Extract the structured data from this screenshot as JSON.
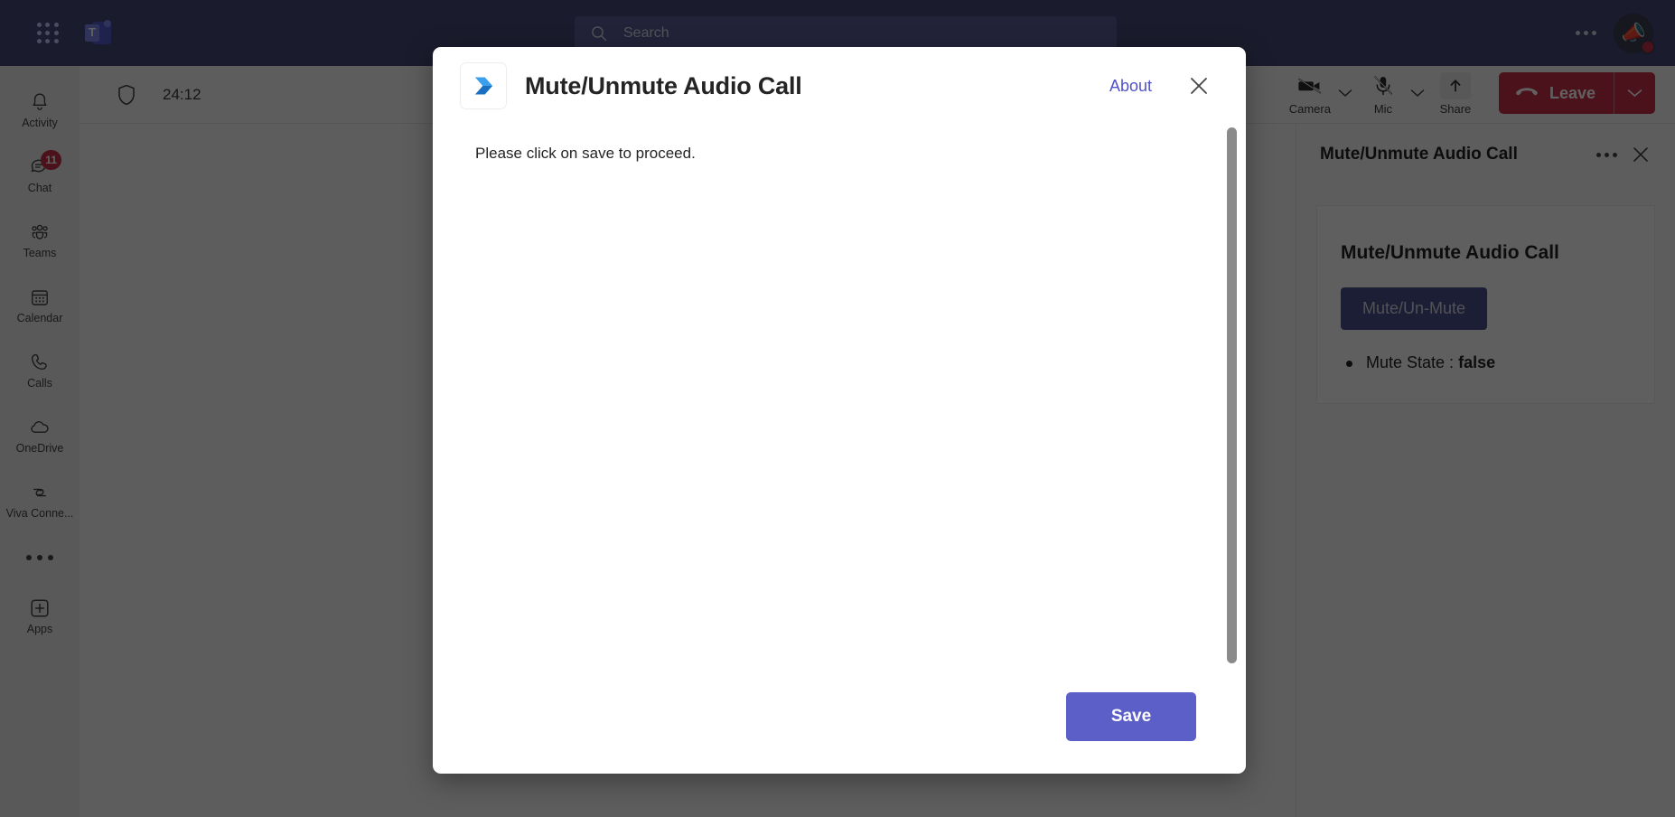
{
  "titlebar": {
    "waffle_icon": "app-launcher-grid-icon",
    "logo_icon": "teams-logo-icon",
    "logo_letter": "T",
    "search": {
      "icon": "search-icon",
      "placeholder": "Search",
      "value": ""
    },
    "more_icon": "ellipsis-icon",
    "avatar": {
      "icon": "megaphone-avatar",
      "glyph": "📣",
      "presence": "busy",
      "presence_color": "#c4314b"
    }
  },
  "rail": {
    "items": [
      {
        "label": "Activity",
        "icon": "bell-icon",
        "badge": null
      },
      {
        "label": "Chat",
        "icon": "chat-bubble-icon",
        "badge": "11"
      },
      {
        "label": "Teams",
        "icon": "people-icon",
        "badge": null
      },
      {
        "label": "Calendar",
        "icon": "calendar-icon",
        "badge": null
      },
      {
        "label": "Calls",
        "icon": "phone-icon",
        "badge": null
      },
      {
        "label": "OneDrive",
        "icon": "cloud-icon",
        "badge": null
      },
      {
        "label": "Viva Conne...",
        "icon": "viva-connections-icon",
        "badge": null
      }
    ],
    "more_icon": "ellipsis-icon",
    "apps": {
      "label": "Apps",
      "icon": "plus-square-icon"
    }
  },
  "call_bar": {
    "shield_icon": "shield-icon",
    "timer": "24:12",
    "controls": [
      {
        "label": "Camera",
        "icon": "camera-off-icon",
        "has_chevron": true
      },
      {
        "label": "Mic",
        "icon": "mic-off-icon",
        "has_chevron": true
      },
      {
        "label": "Share",
        "icon": "share-up-arrow-icon",
        "has_chevron": false
      }
    ],
    "leave": {
      "label": "Leave",
      "icon": "hang-up-icon",
      "color": "#c4314b",
      "chevron_icon": "chevron-down-icon"
    }
  },
  "side_panel": {
    "header_title": "Mute/Unmute Audio Call",
    "more_icon": "ellipsis-icon",
    "close_icon": "close-icon",
    "card": {
      "title": "Mute/Unmute Audio Call",
      "button_label": "Mute/Un-Mute",
      "button_color": "#4b4f8c",
      "items": [
        {
          "label": "Mute State :",
          "value": "false"
        }
      ]
    }
  },
  "dialog": {
    "app_icon": "power-automate-chevron-icon",
    "title": "Mute/Unmute Audio Call",
    "about_label": "About",
    "close_icon": "close-icon",
    "message": "Please click on save to proceed.",
    "save_label": "Save",
    "save_color": "#5b5fc7",
    "scrollbar": "vertical-scrollbar"
  }
}
